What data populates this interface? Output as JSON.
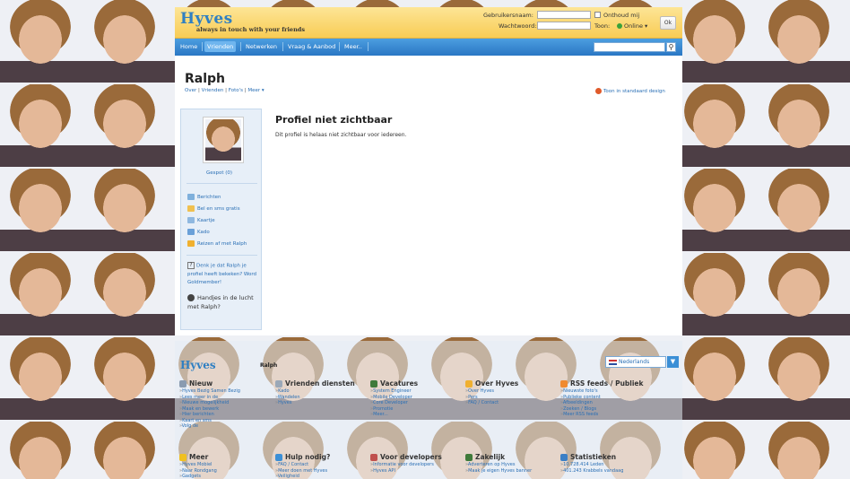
{
  "header": {
    "logo": "Hyves",
    "tagline": "always in touch with your friends",
    "username_label": "Gebruikersnaam:",
    "password_label": "Wachtwoord:",
    "remember_label": "Onthoud mij",
    "show_label": "Toon:",
    "status_value": "Online",
    "ok_label": "Ok"
  },
  "nav": {
    "items": [
      "Home",
      "Vrienden",
      "Netwerken",
      "Vraag & Aanbod",
      "Meer.."
    ],
    "active": "Vrienden"
  },
  "profile": {
    "name": "Ralph",
    "subnav": [
      "Over",
      "Vrienden",
      "Foto's",
      "Meer ▾"
    ],
    "design_link": "Toon in standaard design",
    "gespot": "Gespot (0)",
    "actions": [
      "Berichten",
      "Bel en sms gratis",
      "Kaartje",
      "Kado",
      "Reizen af met Ralph"
    ],
    "help_text": "Denk je dat Ralph je profiel heeft bekeken? Word Goldmember!",
    "handjes_text": "Handjes in de lucht met Ralph?",
    "main_heading": "Profiel niet zichtbaar",
    "main_text": "Dit profiel is helaas niet zichtbaar voor iedereen."
  },
  "footer": {
    "logo": "Hyves",
    "breadcrumb": "Ralph",
    "language": "Nederlands",
    "row1": [
      {
        "title": "Nieuw",
        "icon": "pencil-icon",
        "links": [
          "Hyves Bezig Samen Bezig",
          "Lees meer in de",
          "Nieuwe mogelijkheid",
          "Maak en bewerk",
          "Hier berichten",
          "Kaart en sms",
          "Volg de"
        ]
      },
      {
        "title": "Vrienden diensten",
        "icon": "docs-icon",
        "links": [
          "Kado",
          "Wandelen",
          "Hyves"
        ]
      },
      {
        "title": "Vacatures",
        "icon": "person-icon",
        "links": [
          "System Engineer",
          "Mobile Developer",
          "Core Developer",
          "Promotie",
          "Meer..."
        ]
      },
      {
        "title": "Over Hyves",
        "icon": "folder-icon",
        "links": [
          "Over Hyves",
          "Pers",
          "FAQ / Contact"
        ]
      },
      {
        "title": "RSS feeds / Publiek",
        "icon": "rss-icon",
        "links": [
          "Nieuwste foto's",
          "Publieke content",
          "Afbeeldingen",
          "Zoeken / Blogs",
          "Meer RSS feeds"
        ]
      }
    ],
    "row2": [
      {
        "title": "Meer",
        "icon": "star-icon",
        "links": [
          "Hyves Mobiel",
          "Naar Rondgang",
          "Gadgets"
        ]
      },
      {
        "title": "Hulp nodig?",
        "icon": "help-icon",
        "links": [
          "FAQ / Contact",
          "Meer doen met Hyves",
          "Veiligheid"
        ]
      },
      {
        "title": "Voor developers",
        "icon": "code-icon",
        "links": [
          "Informatie voor developers",
          "Hyves API"
        ]
      },
      {
        "title": "Zakelijk",
        "icon": "person-icon",
        "links": [
          "Adverteren op Hyves",
          "Maak je eigen Hyves banner"
        ]
      },
      {
        "title": "Statistieken",
        "icon": "chart-icon",
        "links": [
          "10.728.414 Leden",
          "401.243 Krabbels vandaag"
        ]
      }
    ]
  },
  "colors": {
    "topbar": "#f8cc55",
    "nav": "#2a77c4",
    "link": "#2a6fb5"
  }
}
